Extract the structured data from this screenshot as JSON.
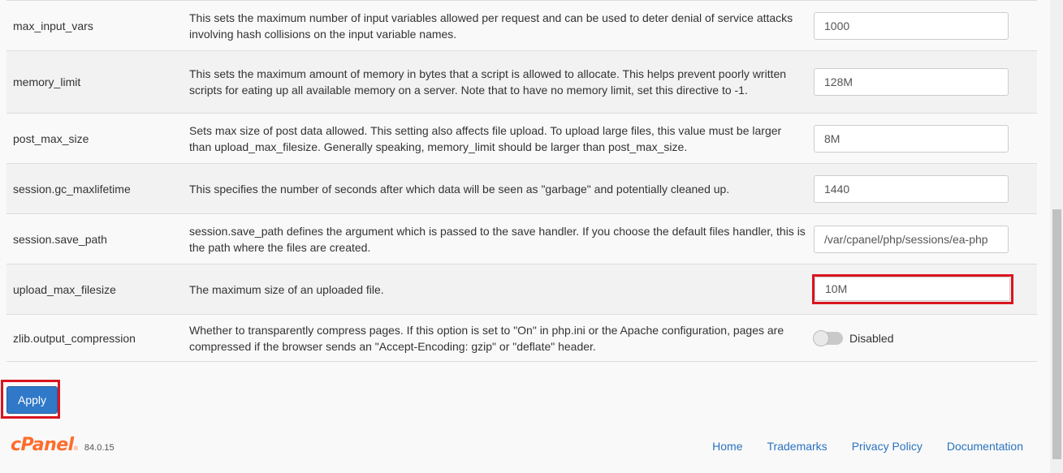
{
  "settings": [
    {
      "name": "max_input_vars",
      "description": "This sets the maximum number of input variables allowed per request and can be used to deter denial of service attacks involving hash collisions on the input variable names.",
      "value": "1000"
    },
    {
      "name": "memory_limit",
      "description": "This sets the maximum amount of memory in bytes that a script is allowed to allocate. This helps prevent poorly written scripts for eating up all available memory on a server. Note that to have no memory limit, set this directive to -1.",
      "value": "128M"
    },
    {
      "name": "post_max_size",
      "description": "Sets max size of post data allowed. This setting also affects file upload. To upload large files, this value must be larger than upload_max_filesize. Generally speaking, memory_limit should be larger than post_max_size.",
      "value": "8M"
    },
    {
      "name": "session.gc_maxlifetime",
      "description": "This specifies the number of seconds after which data will be seen as \"garbage\" and potentially cleaned up.",
      "value": "1440"
    },
    {
      "name": "session.save_path",
      "description": "session.save_path defines the argument which is passed to the save handler. If you choose the default files handler, this is the path where the files are created.",
      "value": "/var/cpanel/php/sessions/ea-php"
    },
    {
      "name": "upload_max_filesize",
      "description": "The maximum size of an uploaded file.",
      "value": "10M"
    },
    {
      "name": "zlib.output_compression",
      "description": "Whether to transparently compress pages. If this option is set to \"On\" in php.ini or the Apache configuration, pages are compressed if the browser sends an \"Accept-Encoding: gzip\" or \"deflate\" header.",
      "toggle_state": "Disabled"
    }
  ],
  "apply_label": "Apply",
  "footer": {
    "logo_text": "cPanel",
    "logo_reg": "®",
    "version": "84.0.15",
    "links": [
      "Home",
      "Trademarks",
      "Privacy Policy",
      "Documentation"
    ]
  },
  "colors": {
    "accent_highlight": "#d9151f",
    "apply_button": "#2f79c8",
    "link": "#2a72bf",
    "logo": "#ff6c2c"
  }
}
